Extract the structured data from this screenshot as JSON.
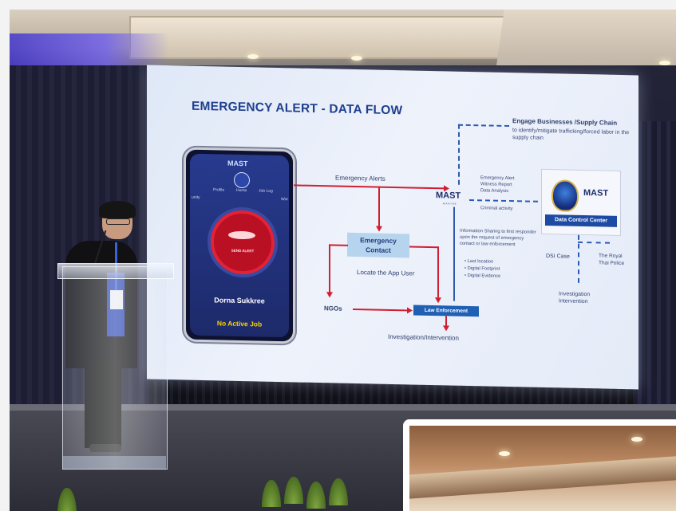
{
  "slide": {
    "title": "EMERGENCY ALERT - DATA FLOW",
    "phone": {
      "logo": "MAST",
      "nav_items": [
        "Profile",
        "Home",
        "Job Log",
        "unity",
        "Wor"
      ],
      "alert_button": "SEND ALERT",
      "name": "Dorna Sukkree",
      "status": "No Active Job"
    },
    "labels": {
      "emergency_alerts": "Emergency Alerts",
      "emergency_contact": "Emergency Contact",
      "locate_user": "Locate the App User",
      "ngos": "NGOs",
      "law_enforcement": "Law Enforcement",
      "investigation": "Investigation/Intervention",
      "engage_title": "Engage Businesses /Supply Chain",
      "engage_body": "to identify/mitigate trafficking/forced labor in the supply chain",
      "alert_info": "Emergency Alert\nWitness Report\nData Analysis",
      "criminal_activity": "Criminal activity",
      "info_sharing": "Information Sharing to first responder upon the request of emergency contact or law enforcement",
      "bullets": [
        "Last location",
        "Digital Footprint",
        "Digital Evidence"
      ],
      "mast_logo": "MAST",
      "mast_sub": "MARINE",
      "data_control_center": "Data Control Center",
      "dsi_case": "DSI Case",
      "royal_thai_police": "The Royal Thai Police",
      "investigation_right": "Investigation Intervention"
    }
  },
  "colors": {
    "slide_title": "#1f3f8f",
    "arrow_red": "#d11f32",
    "arrow_blue": "#2e5bb0",
    "phone_status": "#ffd400"
  }
}
